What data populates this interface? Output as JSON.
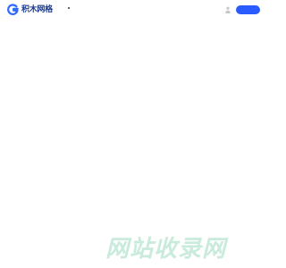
{
  "header": {
    "logo_text": "积木网格",
    "logo_icon": "g-logo-icon",
    "user_icon": "user-icon",
    "accent_color": "#2a5bff"
  },
  "watermark": {
    "text": "网站收录网",
    "color": "#c9ebdc"
  }
}
